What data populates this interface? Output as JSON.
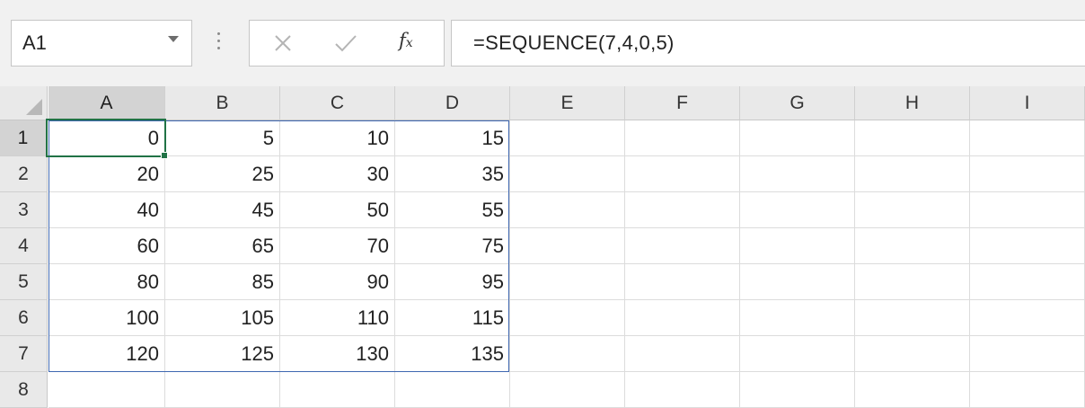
{
  "name_box": {
    "value": "A1"
  },
  "formula_bar": {
    "formula": "=SEQUENCE(7,4,0,5)",
    "insert_function_label": "f",
    "insert_function_sub": "x"
  },
  "sheet": {
    "columns": [
      "A",
      "B",
      "C",
      "D",
      "E",
      "F",
      "G",
      "H",
      "I"
    ],
    "rows": [
      "1",
      "2",
      "3",
      "4",
      "5",
      "6",
      "7",
      "8"
    ],
    "active_cell": "A1",
    "cells": [
      [
        "0",
        "5",
        "10",
        "15",
        "",
        "",
        "",
        "",
        ""
      ],
      [
        "20",
        "25",
        "30",
        "35",
        "",
        "",
        "",
        "",
        ""
      ],
      [
        "40",
        "45",
        "50",
        "55",
        "",
        "",
        "",
        "",
        ""
      ],
      [
        "60",
        "65",
        "70",
        "75",
        "",
        "",
        "",
        "",
        ""
      ],
      [
        "80",
        "85",
        "90",
        "95",
        "",
        "",
        "",
        "",
        ""
      ],
      [
        "100",
        "105",
        "110",
        "115",
        "",
        "",
        "",
        "",
        ""
      ],
      [
        "120",
        "125",
        "130",
        "135",
        "",
        "",
        "",
        "",
        ""
      ],
      [
        "",
        "",
        "",
        "",
        "",
        "",
        "",
        "",
        ""
      ]
    ]
  },
  "colors": {
    "selection_green": "#217346",
    "spill_border_blue": "#3f67b0",
    "header_bg": "#e9e9e9"
  }
}
